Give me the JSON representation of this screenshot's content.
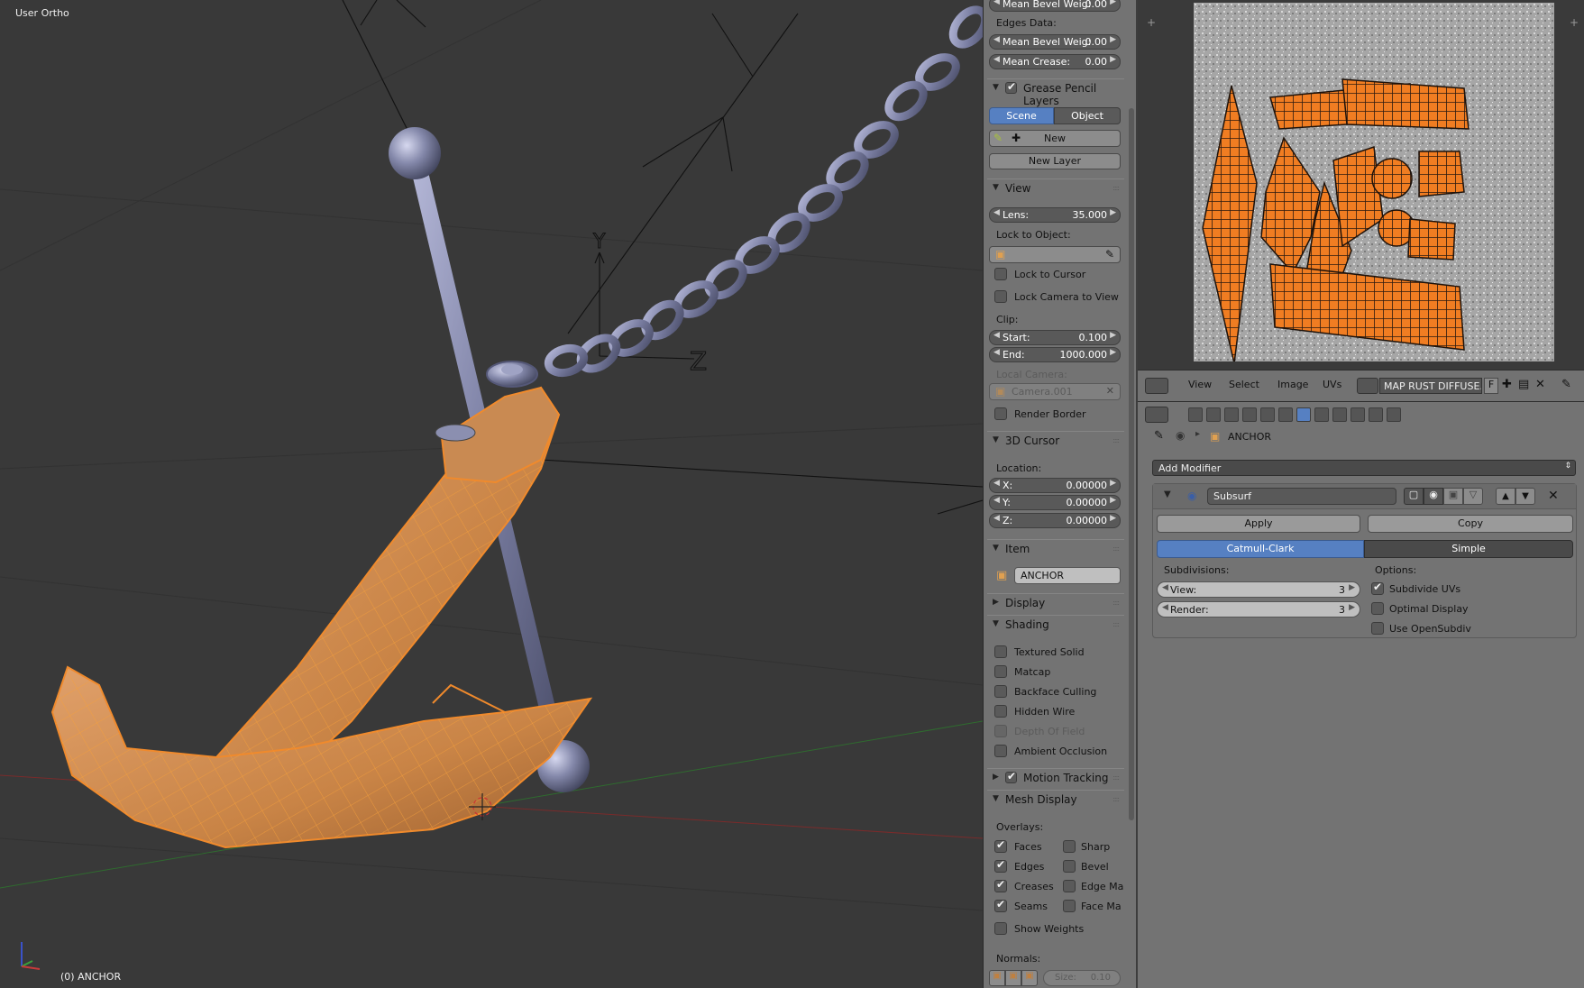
{
  "viewport": {
    "view_label": "User Ortho",
    "object_label": "(0) ANCHOR",
    "axis_y": "Y",
    "axis_z": "Z"
  },
  "npanel": {
    "mean_bevel_weight_vertex": {
      "label": "Mean Bevel Weig:",
      "value": "0.00"
    },
    "edges_data_label": "Edges Data:",
    "mean_bevel_weight_edge": {
      "label": "Mean Bevel Weig:",
      "value": "0.00"
    },
    "mean_crease": {
      "label": "Mean Crease:",
      "value": "0.00"
    },
    "grease_pencil": {
      "title": "Grease Pencil Layers",
      "enabled": true,
      "scene_tab": "Scene",
      "object_tab": "Object",
      "new_label": "New",
      "new_layer_label": "New Layer"
    },
    "view": {
      "title": "View",
      "lens": {
        "label": "Lens:",
        "value": "35.000"
      },
      "lock_to_object_label": "Lock to Object:",
      "lock_to_cursor": "Lock to Cursor",
      "lock_camera_to_view": "Lock Camera to View",
      "clip_label": "Clip:",
      "clip_start": {
        "label": "Start:",
        "value": "0.100"
      },
      "clip_end": {
        "label": "End:",
        "value": "1000.000"
      },
      "local_camera_label": "Local Camera:",
      "local_camera_value": "Camera.001",
      "render_border": "Render Border"
    },
    "cursor": {
      "title": "3D Cursor",
      "location_label": "Location:",
      "x": {
        "label": "X:",
        "value": "0.00000"
      },
      "y": {
        "label": "Y:",
        "value": "0.00000"
      },
      "z": {
        "label": "Z:",
        "value": "0.00000"
      }
    },
    "item": {
      "title": "Item",
      "name": "ANCHOR"
    },
    "display": {
      "title": "Display"
    },
    "shading": {
      "title": "Shading",
      "options": [
        "Textured Solid",
        "Matcap",
        "Backface Culling",
        "Hidden Wire",
        "Depth Of Field",
        "Ambient Occlusion"
      ]
    },
    "motion_tracking": {
      "title": "Motion Tracking",
      "enabled": true
    },
    "mesh_display": {
      "title": "Mesh Display",
      "overlays_label": "Overlays:",
      "left": [
        "Faces",
        "Edges",
        "Creases",
        "Seams"
      ],
      "right": [
        "Sharp",
        "Bevel",
        "Edge Ma",
        "Face Ma"
      ],
      "show_weights": "Show Weights",
      "normals_label": "Normals:",
      "size": {
        "label": "Size:",
        "value": "0.10"
      }
    }
  },
  "uv_header": {
    "menus": [
      "View",
      "Select",
      "Image",
      "UVs"
    ],
    "image_name": "MAP RUST DIFFUSE...",
    "fake_user": "F"
  },
  "properties": {
    "object_name": "ANCHOR",
    "add_modifier_label": "Add Modifier",
    "modifier": {
      "name": "Subsurf",
      "apply_label": "Apply",
      "copy_label": "Copy",
      "tab_catmull": "Catmull-Clark",
      "tab_simple": "Simple",
      "subdivisions_label": "Subdivisions:",
      "view": {
        "label": "View:",
        "value": "3"
      },
      "render": {
        "label": "Render:",
        "value": "3"
      },
      "options_label": "Options:",
      "subdivide_uvs": "Subdivide UVs",
      "optimal_display": "Optimal Display",
      "use_opensubdiv": "Use OpenSubdiv"
    }
  },
  "colors": {
    "accent_blue": "#5680c2",
    "selection_orange": "#f08a2c",
    "viewport_bg": "#393939",
    "panel_bg": "#737373"
  }
}
